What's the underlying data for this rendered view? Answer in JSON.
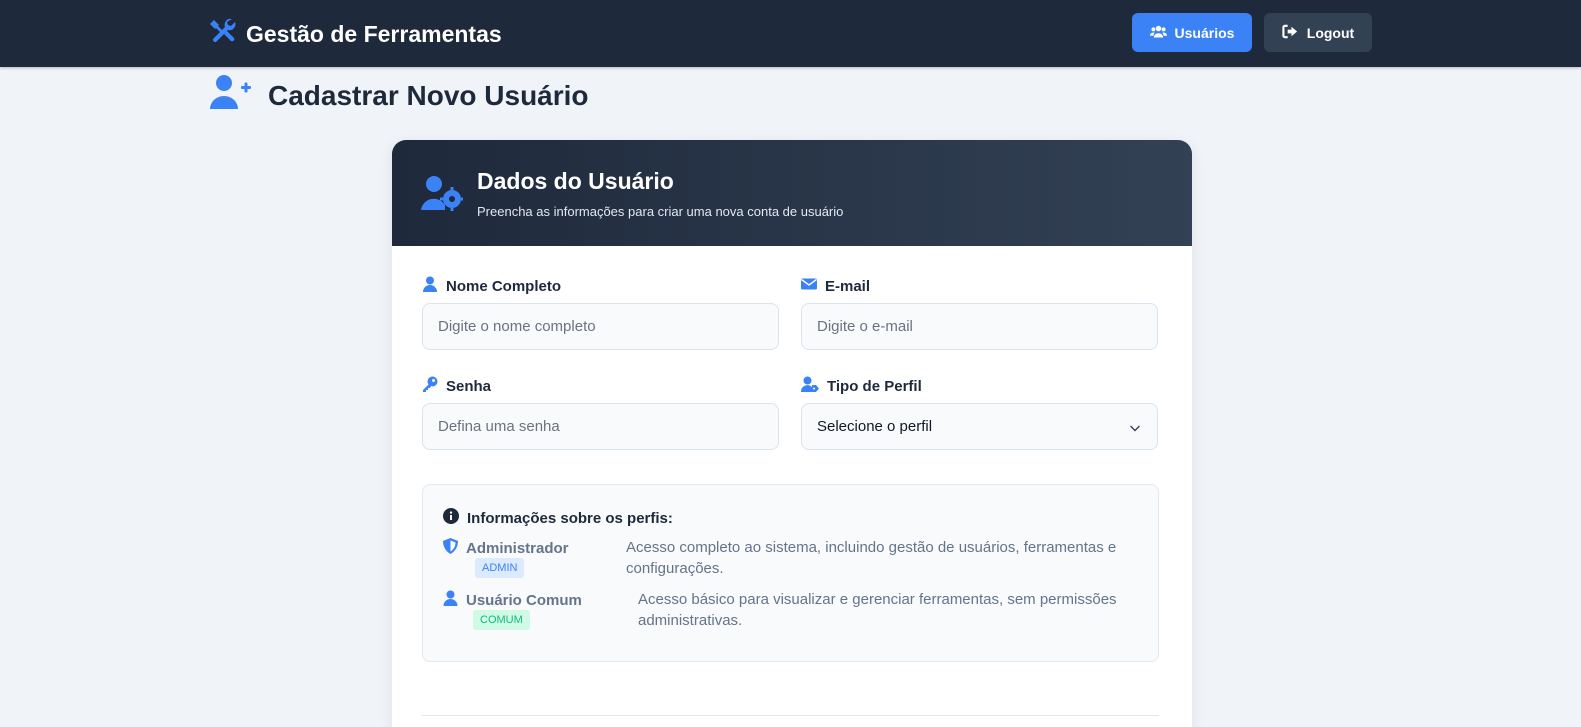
{
  "navbar": {
    "brand": "Gestão de Ferramentas",
    "brand_icon": "tools-icon",
    "users_button": "Usuários",
    "logout_button": "Logout"
  },
  "page": {
    "title": "Cadastrar Novo Usuário",
    "title_icon": "user-plus-icon"
  },
  "card": {
    "title": "Dados do Usuário",
    "subtitle": "Preencha as informações para criar uma nova conta de usuário"
  },
  "form": {
    "name": {
      "label": "Nome Completo",
      "placeholder": "Digite o nome completo",
      "value": ""
    },
    "email": {
      "label": "E-mail",
      "placeholder": "Digite o e-mail",
      "value": ""
    },
    "password": {
      "label": "Senha",
      "placeholder": "Defina uma senha",
      "value": ""
    },
    "profile": {
      "label": "Tipo de Perfil",
      "selected": "Selecione o perfil"
    }
  },
  "profiles_info": {
    "title": "Informações sobre os perfis:",
    "admin": {
      "name": "Administrador",
      "badge": "ADMIN",
      "description": "Acesso completo ao sistema, incluindo gestão de usuários, ferramentas e configurações."
    },
    "common": {
      "name": "Usuário Comum",
      "badge": "COMUM",
      "description": "Acesso básico para visualizar e gerenciar ferramentas, sem permissões administrativas."
    }
  },
  "colors": {
    "navbar_bg": "#1e293b",
    "accent": "#3b82f6",
    "page_bg": "#f0f4f8",
    "admin_badge": "#dbeafe",
    "comum_badge": "#d1fae5"
  }
}
